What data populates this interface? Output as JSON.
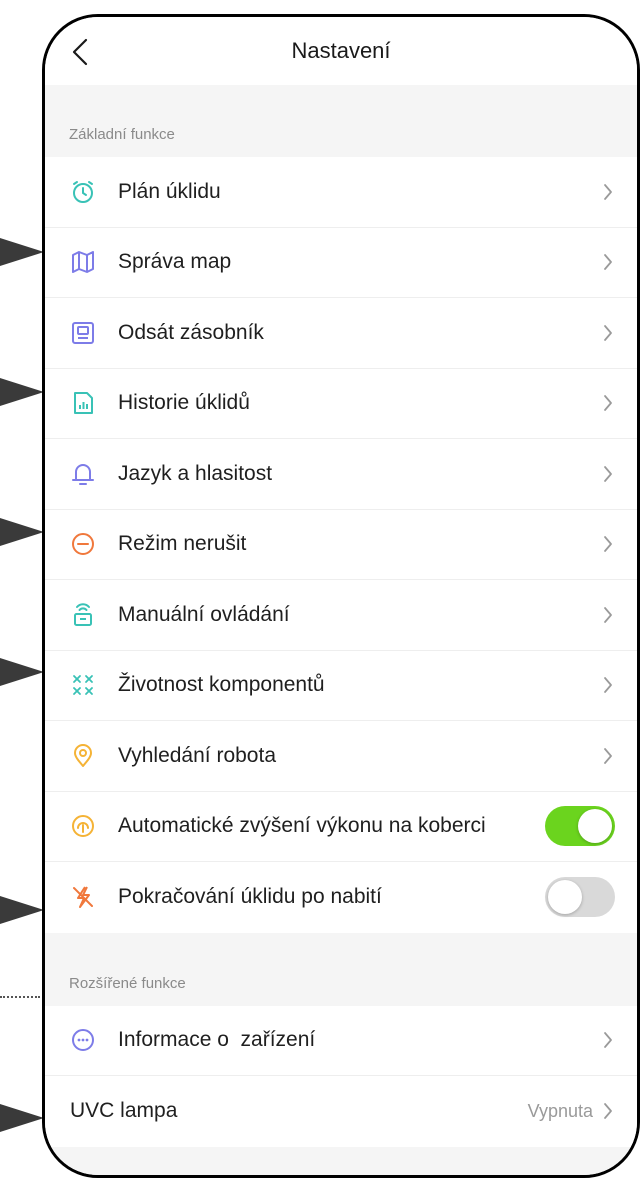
{
  "header": {
    "title": "Nastavení"
  },
  "colors": {
    "toggle_on": "#6bd41e",
    "toggle_off": "#d9d9d9",
    "teal": "#39c2b6",
    "purple": "#7d7ce8",
    "orange": "#f39a5a",
    "amber": "#f5b336",
    "red_orange": "#f0783c"
  },
  "sections": [
    {
      "title": "Základní funkce",
      "items": [
        {
          "label": "Plán úklidu",
          "icon": "alarm-clock-icon"
        },
        {
          "label": "Správa map",
          "icon": "map-icon"
        },
        {
          "label": "Odsát zásobník",
          "icon": "dustbin-station-icon"
        },
        {
          "label": "Historie úklidů",
          "icon": "history-chart-icon"
        },
        {
          "label": "Jazyk a hlasitost",
          "icon": "bell-icon"
        },
        {
          "label": "Režim nerušit",
          "icon": "do-not-disturb-icon"
        },
        {
          "label": "Manuální ovládání",
          "icon": "remote-control-icon"
        },
        {
          "label": "Životnost komponentů",
          "icon": "components-icon"
        },
        {
          "label": "Vyhledání robota",
          "icon": "location-pin-icon"
        },
        {
          "label": "Automatické zvýšení výkonu na koberci",
          "icon": "carpet-boost-icon",
          "toggle": "on"
        },
        {
          "label": "Pokračování úklidu po nabití",
          "icon": "charging-bolt-icon",
          "toggle": "off"
        }
      ]
    },
    {
      "title": "Rozšířené funkce",
      "items": [
        {
          "label": "Informace o  zařízení",
          "icon": "info-dots-icon"
        },
        {
          "label": "UVC lampa",
          "value": "Vypnuta"
        }
      ]
    }
  ]
}
